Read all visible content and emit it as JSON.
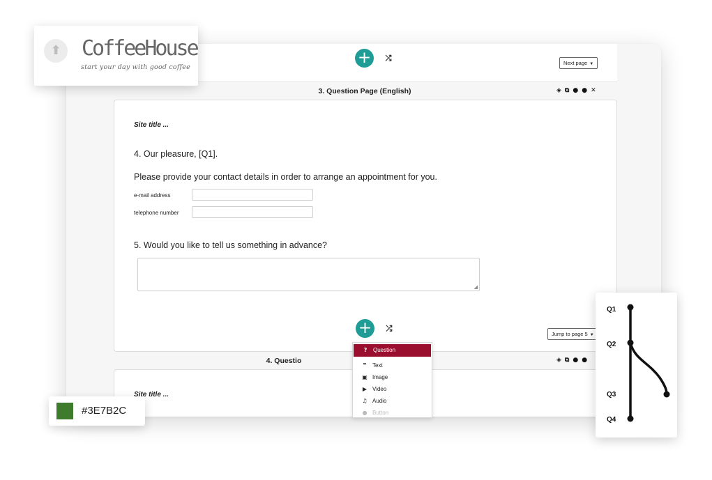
{
  "top_panel": {
    "add_icon": "plus-icon",
    "shuffle_icon": "shuffle-icon",
    "next_page_label": "Next page"
  },
  "page3": {
    "title": "3. Question Page (English)",
    "tools": [
      "visibility-icon",
      "copy-icon",
      "move-down-icon",
      "move-up-icon",
      "close-icon"
    ],
    "site_title": "Site title ...",
    "q4_text": "4. Our pleasure, [Q1].",
    "q4_instruction": "Please provide your contact details in order to arrange an appointment for you.",
    "email_label": "e-mail address",
    "email_value": "",
    "phone_label": "telephone number",
    "phone_value": "",
    "q5_text": "5. Would you like to tell us something in advance?",
    "q5_value": "",
    "jump_label": "Jump to page 5"
  },
  "page4": {
    "title": "4. Questio",
    "site_title": "Site title ..."
  },
  "add_menu": {
    "items": [
      {
        "label": "Question",
        "icon": "question-icon",
        "glyph": "?"
      },
      {
        "label": "Text",
        "icon": "quote-icon",
        "glyph": "❞"
      },
      {
        "label": "Image",
        "icon": "image-icon",
        "glyph": "▣"
      },
      {
        "label": "Video",
        "icon": "video-icon",
        "glyph": "▶"
      },
      {
        "label": "Audio",
        "icon": "music-icon",
        "glyph": "♫"
      },
      {
        "label": "Button",
        "icon": "button-icon",
        "glyph": "●"
      }
    ],
    "active_color": "#9B0F2E"
  },
  "logo": {
    "name": "CoffeeHouse",
    "tagline": "start your day with good coffee",
    "upload_icon": "upload-arrow-icon"
  },
  "color_swatch": {
    "color": "#3E7B2C",
    "label": "#3E7B2C"
  },
  "flow": {
    "nodes": [
      "Q1",
      "Q2",
      "Q3",
      "Q4"
    ]
  },
  "colors": {
    "accent": "#1F9C96",
    "menu_active": "#9B0F2E"
  }
}
